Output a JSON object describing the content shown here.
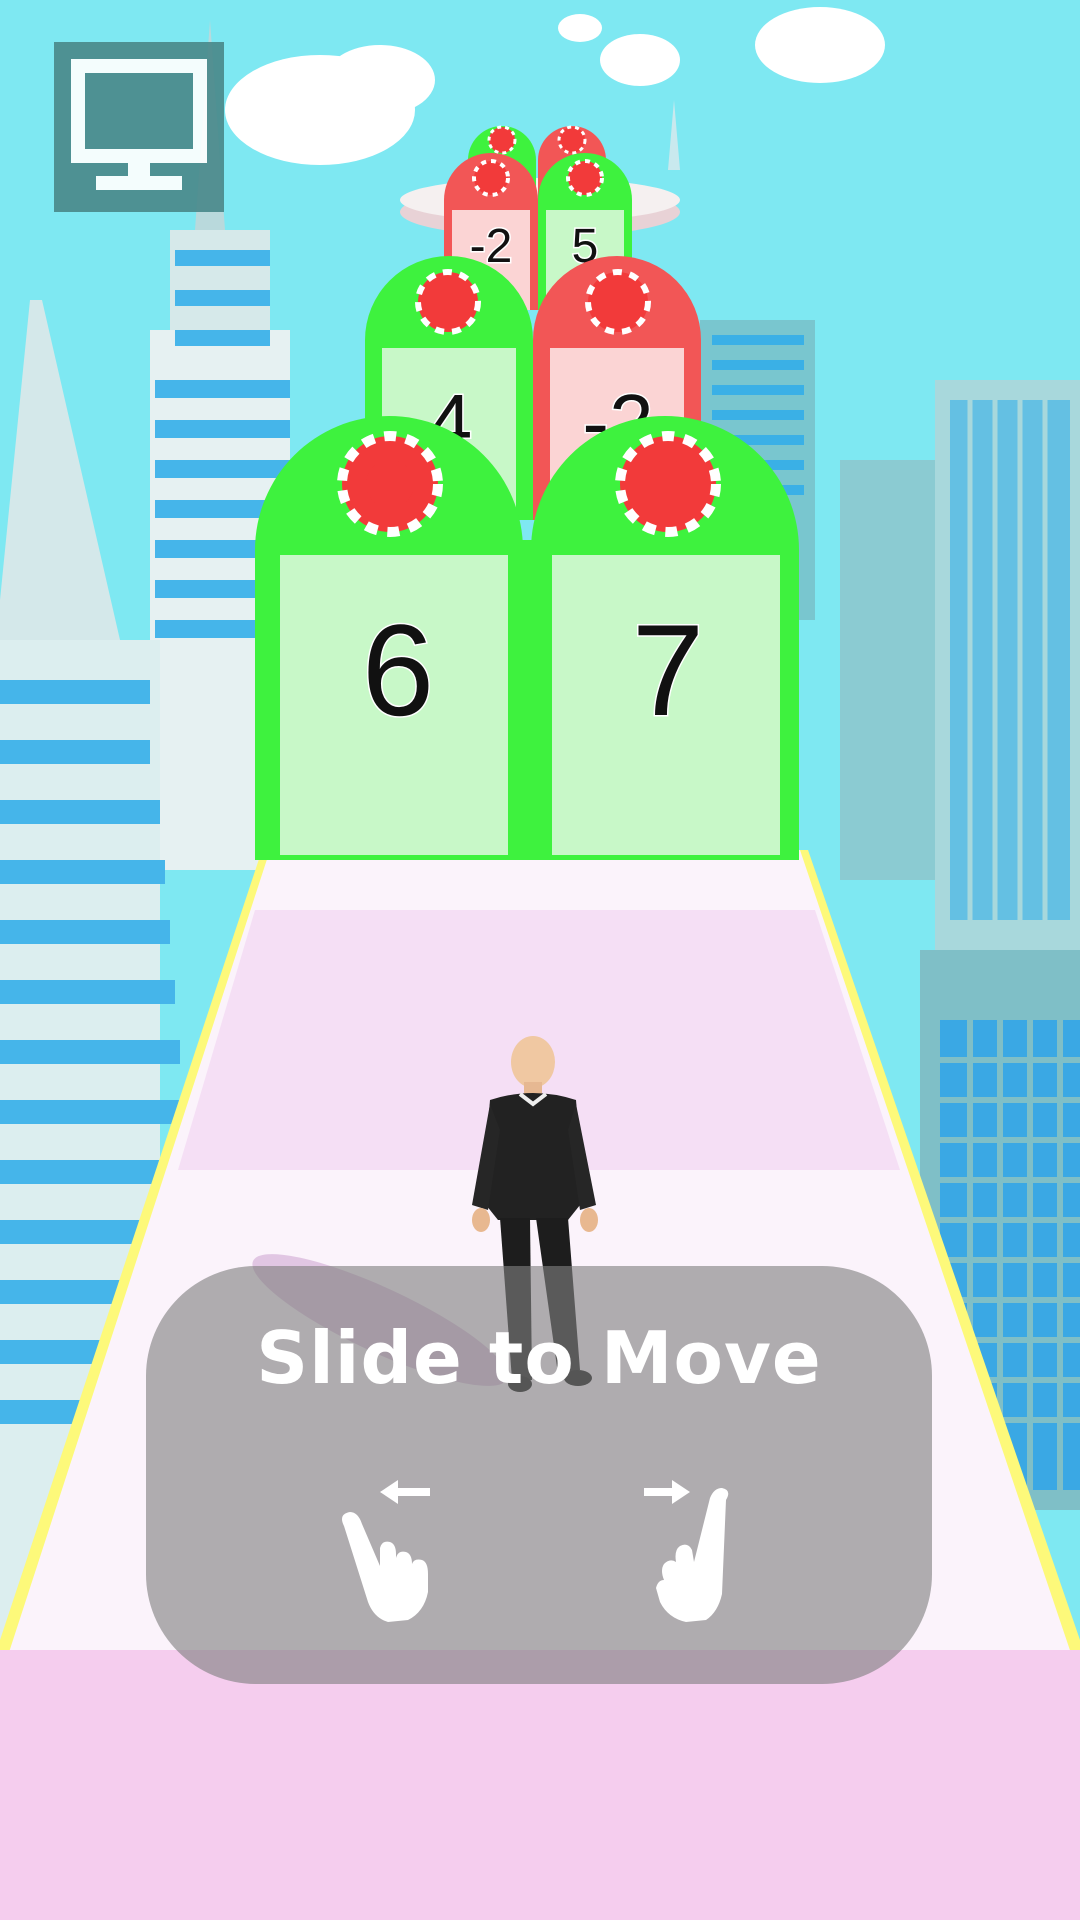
{
  "hud": {
    "menu_icon": "monitor-icon"
  },
  "gates": {
    "row1": {
      "left": "6",
      "right": "7"
    },
    "row2": {
      "left": "4",
      "right": "-2"
    },
    "row3": {
      "left": "-2",
      "right": "5"
    }
  },
  "tutorial": {
    "text": "Slide to Move",
    "left_icon": "swipe-left-hand-icon",
    "right_icon": "swipe-right-hand-icon"
  },
  "colors": {
    "sky": "#7ee8f2",
    "gate_green": "#3ef23e",
    "gate_red": "#f25656",
    "chip_red": "#f23a3a",
    "road_pink": "#f5d0ef",
    "road_white": "#fbf3fb",
    "road_edge": "#fdf97a"
  }
}
